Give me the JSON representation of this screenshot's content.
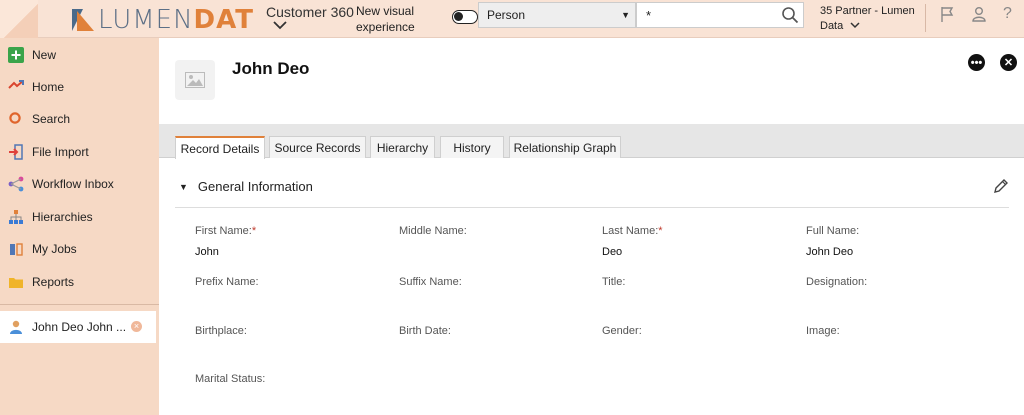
{
  "header": {
    "logo_part1": "LUMEN",
    "logo_part2": "DAT",
    "product": "Customer 360",
    "new_visual": "New visual experience",
    "entity_type": "Person",
    "search_value": "*",
    "tenant": "35 Partner - Lumen Data",
    "icons": [
      "flag-icon",
      "user-icon",
      "help-icon"
    ]
  },
  "sidebar": {
    "items": [
      {
        "label": "New",
        "icon": "plus-icon"
      },
      {
        "label": "Home",
        "icon": "home-icon"
      },
      {
        "label": "Search",
        "icon": "search-icon"
      },
      {
        "label": "File Import",
        "icon": "file-import-icon"
      },
      {
        "label": "Workflow Inbox",
        "icon": "workflow-icon"
      },
      {
        "label": "Hierarchies",
        "icon": "hierarchy-icon"
      },
      {
        "label": "My Jobs",
        "icon": "jobs-icon"
      },
      {
        "label": "Reports",
        "icon": "folder-icon"
      }
    ],
    "recent": {
      "label": "John Deo John ...",
      "icon": "person-icon"
    }
  },
  "record": {
    "title": "John Deo",
    "tabs": [
      "Record Details",
      "Source Records",
      "Hierarchy",
      "History",
      "Relationship Graph"
    ],
    "active_tab": "Record Details",
    "section_title": "General Information",
    "fields": [
      {
        "label": "First Name:",
        "required": true,
        "value": "John"
      },
      {
        "label": "Middle Name:",
        "required": false,
        "value": ""
      },
      {
        "label": "Last Name:",
        "required": true,
        "value": "Deo"
      },
      {
        "label": "Full Name:",
        "required": false,
        "value": "John Deo"
      },
      {
        "label": "Prefix Name:",
        "required": false,
        "value": ""
      },
      {
        "label": "Suffix Name:",
        "required": false,
        "value": ""
      },
      {
        "label": "Title:",
        "required": false,
        "value": ""
      },
      {
        "label": "Designation:",
        "required": false,
        "value": ""
      },
      {
        "label": "Birthplace:",
        "required": false,
        "value": ""
      },
      {
        "label": "Birth Date:",
        "required": false,
        "value": ""
      },
      {
        "label": "Gender:",
        "required": false,
        "value": ""
      },
      {
        "label": "Image:",
        "required": false,
        "value": ""
      },
      {
        "label": "Marital Status:",
        "required": false,
        "value": ""
      }
    ]
  },
  "colors": {
    "accent": "#e0813a",
    "sidebar_bg": "#f6d9c5",
    "header_bg": "#f9e3d5"
  }
}
